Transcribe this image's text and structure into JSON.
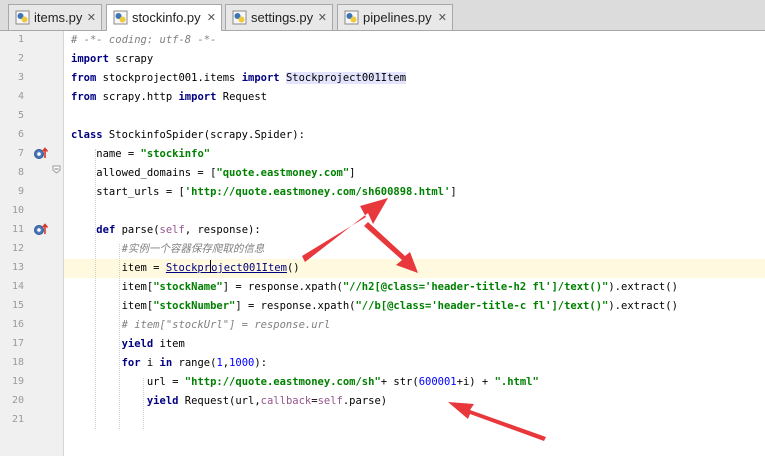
{
  "tabs": [
    {
      "label": "items.py",
      "close": "✕",
      "active": false
    },
    {
      "label": "stockinfo.py",
      "close": "✕",
      "active": true
    },
    {
      "label": "settings.py",
      "close": "✕",
      "active": false
    },
    {
      "label": "pipelines.py",
      "close": "✕",
      "active": false
    }
  ],
  "line_numbers": [
    "1",
    "2",
    "3",
    "4",
    "5",
    "6",
    "7",
    "8",
    "9",
    "10",
    "11",
    "12",
    "13",
    "14",
    "15",
    "16",
    "17",
    "18",
    "19",
    "20",
    "21"
  ],
  "code": {
    "l1": "# -*- coding: utf-8 -*-",
    "l2_kw": "import",
    "l2_rest": " scrapy",
    "l3_kw1": "from",
    "l3_mod": " stockproject001.items ",
    "l3_kw2": "import",
    "l3_cls": "Stockproject001Item",
    "l4_kw1": "from",
    "l4_mod": " scrapy.http ",
    "l4_kw2": "import",
    "l4_cls": " Request",
    "l6_kw": "class",
    "l6_rest": " StockinfoSpider(scrapy.Spider):",
    "l7_pre": "    name = ",
    "l7_str": "\"stockinfo\"",
    "l8_pre": "    allowed_domains = [",
    "l8_str": "\"quote.eastmoney.com\"",
    "l8_post": "]",
    "l9_pre": "    start_urls = [",
    "l9_str": "'http://quote.eastmoney.com/sh600898.html'",
    "l9_post": "]",
    "l11_pre": "    ",
    "l11_kw": "def",
    "l11_name": " parse(",
    "l11_self": "self",
    "l11_post": ", response):",
    "l12": "        #实例一个容器保存爬取的信息",
    "l13_pre": "        item = ",
    "l13_link_a": "Stockpr",
    "l13_link_b": "oject001Item",
    "l13_post": "()",
    "l14_pre": "        item[",
    "l14_key": "\"stockName\"",
    "l14_mid": "] = response.xpath(",
    "l14_str": "\"//h2[@class='header-title-h2 fl']/text()\"",
    "l14_post": ").extract()",
    "l15_pre": "        item[",
    "l15_key": "\"stockNumber\"",
    "l15_mid": "] = response.xpath(",
    "l15_str": "\"//b[@class='header-title-c fl']/text()\"",
    "l15_post": ").extract()",
    "l16": "        # item[\"stockUrl\"] = response.url",
    "l17_pre": "        ",
    "l17_kw": "yield",
    "l17_post": " item",
    "l18_pre": "        ",
    "l18_kw1": "for",
    "l18_mid": " i ",
    "l18_kw2": "in",
    "l18_fn": " range(",
    "l18_n1": "1",
    "l18_c": ",",
    "l18_n2": "1000",
    "l18_post": "):",
    "l19_pre": "            url = ",
    "l19_str1": "\"http://quote.eastmoney.com/sh\"",
    "l19_mid": "+ str(",
    "l19_num": "600001",
    "l19_mid2": "+i) + ",
    "l19_str2": "\".html\"",
    "l20_pre": "            ",
    "l20_kw": "yield",
    "l20_mid": " Request(url,",
    "l20_arg": "callback",
    "l20_eq": "=",
    "l20_self": "self",
    "l20_post": ".parse)"
  },
  "colors": {
    "keyword": "#000080",
    "string": "#008000",
    "comment": "#808080",
    "number": "#0000ff",
    "self": "#94558d",
    "arrow": "#e8383b",
    "current_line": "#fffadf"
  },
  "icons": [
    "python-file-icon",
    "override-marker-icon",
    "fold-icon"
  ]
}
